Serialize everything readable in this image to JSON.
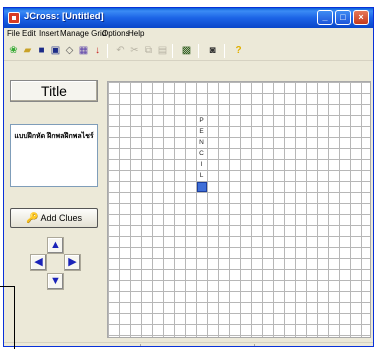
{
  "window": {
    "title": "JCross: [Untitled]",
    "controls": {
      "minimize": "_",
      "maximize": "□",
      "close": "×"
    }
  },
  "menu": [
    "File",
    "Edit",
    "Insert",
    "Manage Grid",
    "Options",
    "Help"
  ],
  "toolbar": {
    "icons": [
      "new-icon",
      "open-icon",
      "save-icon",
      "save-as-icon",
      "eraser-icon",
      "web-page-icon",
      "export-icon",
      "undo-icon",
      "cut-icon",
      "copy-icon",
      "paste-icon",
      "grid-icon",
      "config-icon",
      "help-icon"
    ]
  },
  "left_panel": {
    "title_button": "Title",
    "title_text": "แบบฝึกหัด ฝึกพลฝึกพลไชร์",
    "add_clues": "Add Clues"
  },
  "grid": {
    "rows": 23,
    "cols": 24,
    "letters": [
      {
        "char": "P",
        "row": 3,
        "col": 8
      },
      {
        "char": "E",
        "row": 4,
        "col": 8
      },
      {
        "char": "N",
        "row": 5,
        "col": 8
      },
      {
        "char": "C",
        "row": 6,
        "col": 8
      },
      {
        "char": "I",
        "row": 7,
        "col": 8
      },
      {
        "char": "L",
        "row": 8,
        "col": 8
      }
    ],
    "cursor": {
      "row": 9,
      "col": 8
    }
  },
  "colors": {
    "titlebar": "#0a5fd8",
    "cursor": "#3f6fd8",
    "arrows": "#1a23b8"
  }
}
